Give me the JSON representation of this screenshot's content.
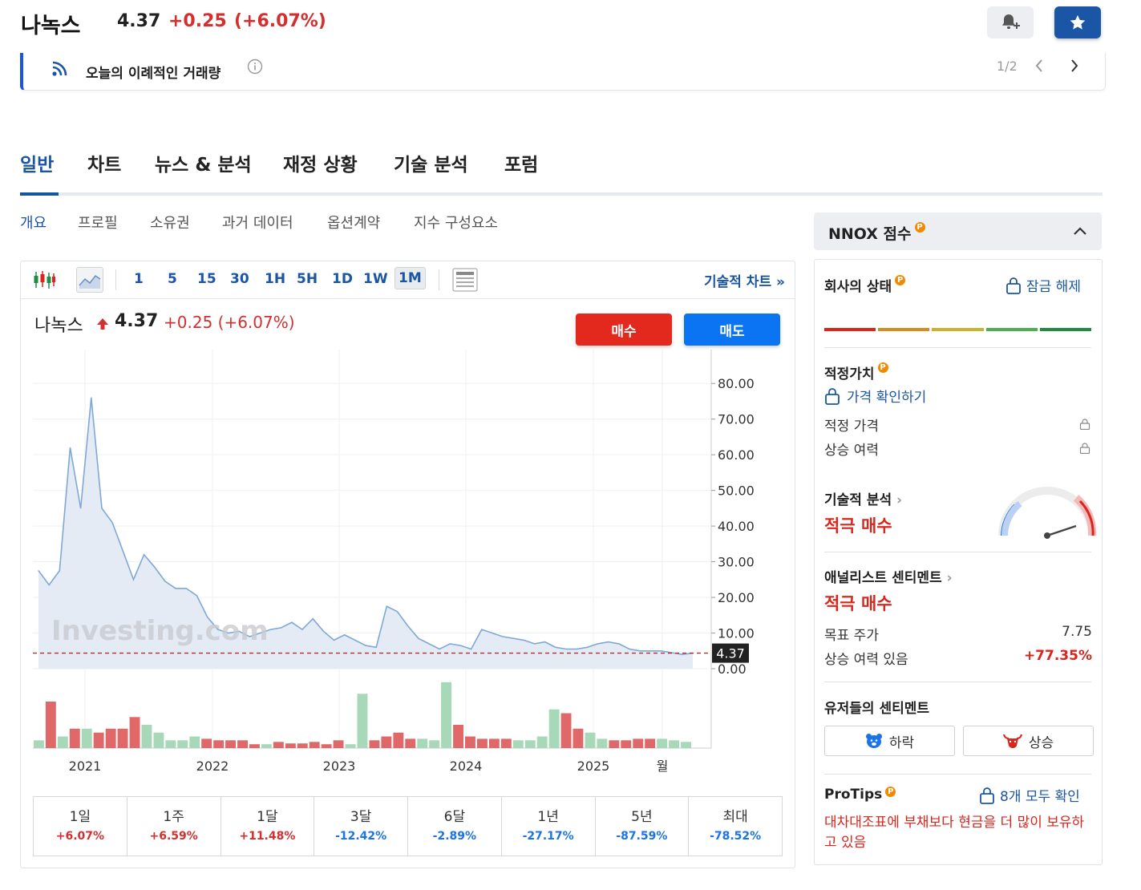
{
  "header": {
    "stock_name": "나녹스",
    "price": "4.37",
    "change": "+0.25",
    "change_pct": "(+6.07%)"
  },
  "ticker": {
    "text": "오늘의 이례적인 거래량",
    "pager": "1/2"
  },
  "main_tabs": [
    "일반",
    "차트",
    "뉴스 & 분석",
    "재정 상황",
    "기술 분석",
    "포럼"
  ],
  "sub_tabs": [
    "개요",
    "프로필",
    "소유권",
    "과거 데이터",
    "옵션계약",
    "지수 구성요소"
  ],
  "chart_toolbar": {
    "timeframes": [
      "1",
      "5",
      "15",
      "30",
      "1H",
      "5H",
      "1D",
      "1W",
      "1M"
    ],
    "selected": "1M",
    "tech_chart_link": "기술적 차트"
  },
  "chart_header": {
    "name": "나녹스",
    "price": "4.37",
    "change": "+0.25 (+6.07%)",
    "buy_label": "매수",
    "sell_label": "매도"
  },
  "chart_data": {
    "type": "area",
    "watermark": "Investing.com",
    "y_ticks": [
      "80.00",
      "70.00",
      "60.00",
      "50.00",
      "40.00",
      "30.00",
      "20.00",
      "10.00",
      "0.00"
    ],
    "ylim": [
      0,
      85
    ],
    "x_ticks": [
      "2021",
      "2022",
      "2023",
      "2024",
      "2025",
      "월"
    ],
    "current_price_label": "4.37",
    "current_price": 4.37,
    "price_series": [
      27.5,
      23.5,
      27.5,
      62,
      45,
      76,
      45,
      41,
      33,
      25,
      32,
      28.5,
      24.5,
      22.5,
      22.5,
      20.5,
      14.5,
      11,
      10,
      10.5,
      9,
      10,
      11,
      11.5,
      13,
      11,
      14,
      10.5,
      8,
      9.5,
      8,
      6.5,
      6,
      17.5,
      16,
      12,
      8.5,
      7,
      5.5,
      7,
      6.5,
      5.5,
      11,
      10,
      9,
      8.5,
      8,
      7,
      7.5,
      6,
      5.5,
      5.5,
      6,
      7,
      7.5,
      7,
      5.5,
      5,
      5,
      5,
      4.5,
      4,
      4.37
    ],
    "volume_series": [
      1,
      6,
      1.5,
      2.5,
      2.5,
      2,
      2.5,
      2.5,
      4,
      3,
      2,
      1,
      1,
      1.5,
      1.2,
      1,
      1,
      1,
      0.5,
      0.5,
      0.8,
      0.6,
      0.6,
      0.8,
      0.5,
      1,
      0.5,
      7,
      1,
      1.5,
      2,
      1.2,
      1.2,
      1,
      8.5,
      3,
      1.5,
      1.2,
      1.2,
      1.2,
      1,
      1,
      1.5,
      5,
      4.5,
      2.5,
      2,
      1.2,
      1,
      1,
      1.2,
      1.2,
      1.2,
      1,
      0.8
    ],
    "volume_up": [
      true,
      false,
      true,
      false,
      true,
      false,
      false,
      false,
      false,
      true,
      true,
      true,
      true,
      true,
      false,
      false,
      false,
      false,
      false,
      true,
      false,
      false,
      false,
      false,
      false,
      false,
      true,
      true,
      false,
      false,
      false,
      false,
      true,
      true,
      true,
      false,
      false,
      false,
      false,
      false,
      true,
      true,
      true,
      true,
      false,
      false,
      true,
      true,
      false,
      false,
      false,
      false,
      true,
      true,
      true
    ]
  },
  "performance": [
    {
      "label": "1일",
      "value": "+6.07%",
      "up": true
    },
    {
      "label": "1주",
      "value": "+6.59%",
      "up": true
    },
    {
      "label": "1달",
      "value": "+11.48%",
      "up": true
    },
    {
      "label": "3달",
      "value": "-12.42%",
      "up": false
    },
    {
      "label": "6달",
      "value": "-2.89%",
      "up": false
    },
    {
      "label": "1년",
      "value": "-27.17%",
      "up": false
    },
    {
      "label": "5년",
      "value": "-87.59%",
      "up": false
    },
    {
      "label": "최대",
      "value": "-78.52%",
      "up": false
    }
  ],
  "sidebar": {
    "score_title": "NNOX 점수",
    "company_status": "회사의 상태",
    "unlock": "잠금 해제",
    "status_colors": [
      "#d8261c",
      "#d88a1c",
      "#c9b32a",
      "#4caf50",
      "#1e8e3e"
    ],
    "fair_value": "적정가치",
    "check_price": "가격 확인하기",
    "fair_price": "적정 가격",
    "upside": "상승 여력",
    "tech_analysis": "기술적 분석",
    "tech_verdict": "적극 매수",
    "analyst_sentiment": "애널리스트 센티멘트",
    "analyst_verdict": "적극 매수",
    "target_price_label": "목표 주가",
    "target_price": "7.75",
    "potential_label": "상승 여력 있음",
    "potential": "+77.35%",
    "user_sentiment": "유저들의 센티멘트",
    "bear_label": "하락",
    "bull_label": "상승",
    "protips": "ProTips",
    "protips_link": "8개 모두 확인",
    "protip_text": "대차대조표에 부채보다 현금을 더 많이 보유하고 있음"
  },
  "colors": {
    "accent": "#1a55a6",
    "up": "#d32f2f",
    "down": "#1a73e8",
    "buy": "#e3291e",
    "sell": "#0a74f2"
  }
}
